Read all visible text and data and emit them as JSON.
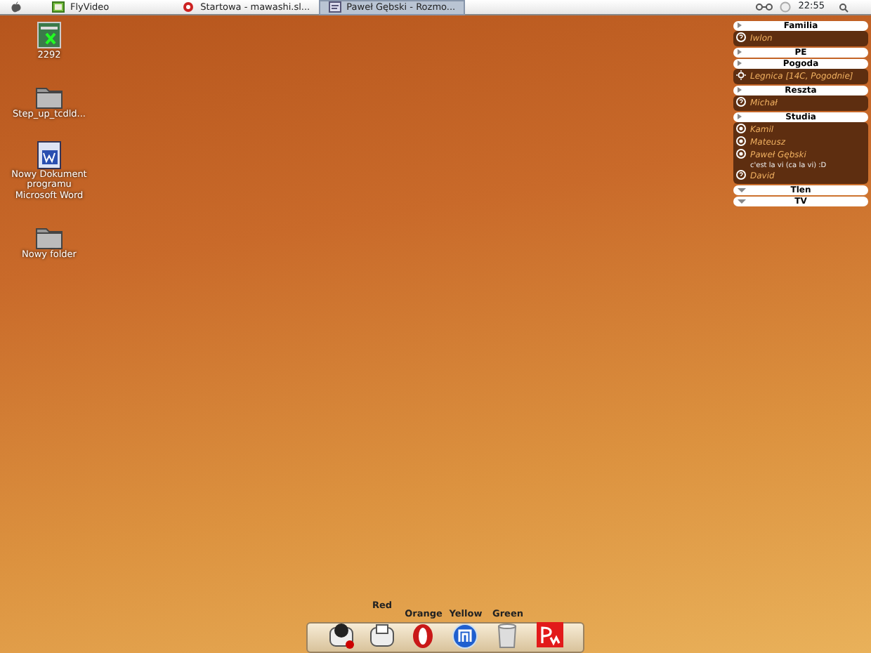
{
  "menubar": {
    "tabs": [
      {
        "label": "FlyVideo",
        "kind": "video",
        "selected": false
      },
      {
        "label": "Startowa - mawashi.sl...",
        "kind": "browser",
        "selected": false
      },
      {
        "label": "Paweł Gębski - Rozmo...",
        "kind": "chat",
        "selected": true
      }
    ],
    "clock": "22:55"
  },
  "desktop_icons": [
    {
      "label": "2292",
      "kind": "sheet"
    },
    {
      "label": "Step_up_tcdld...",
      "kind": "folder"
    },
    {
      "label": "Nowy Dokument programu Microsoft Word",
      "kind": "doc"
    },
    {
      "label": "Nowy folder",
      "kind": "folder"
    }
  ],
  "contacts": {
    "groups": [
      {
        "name": "Familia",
        "expanded": true,
        "items": [
          {
            "name": "Iwlon",
            "kind": "away"
          }
        ]
      },
      {
        "name": "PE",
        "expanded": true
      },
      {
        "name": "Pogoda",
        "expanded": true,
        "items": [
          {
            "name": "Legnica [14C, Pogodnie]",
            "kind": "weather"
          }
        ]
      },
      {
        "name": "Reszta",
        "expanded": true,
        "items": [
          {
            "name": "Michał",
            "kind": "away"
          }
        ]
      },
      {
        "name": "Studia",
        "expanded": true,
        "items": [
          {
            "name": "Kamil",
            "kind": "online"
          },
          {
            "name": "Mateusz",
            "kind": "online"
          },
          {
            "name": "Paweł Gębski",
            "kind": "online",
            "description": "c'est la vi (ca la vi) :D"
          },
          {
            "name": "David",
            "kind": "away"
          }
        ]
      },
      {
        "name": "Tlen",
        "expanded": false
      },
      {
        "name": "TV",
        "expanded": false
      }
    ]
  },
  "dock": [
    {
      "kind": "mascot"
    },
    {
      "kind": "mascot2",
      "label": "Red"
    },
    {
      "kind": "opera",
      "label": "Orange"
    },
    {
      "kind": "maxthon",
      "label": "Yellow"
    },
    {
      "kind": "trash",
      "label": "Green"
    },
    {
      "kind": "logo"
    }
  ]
}
